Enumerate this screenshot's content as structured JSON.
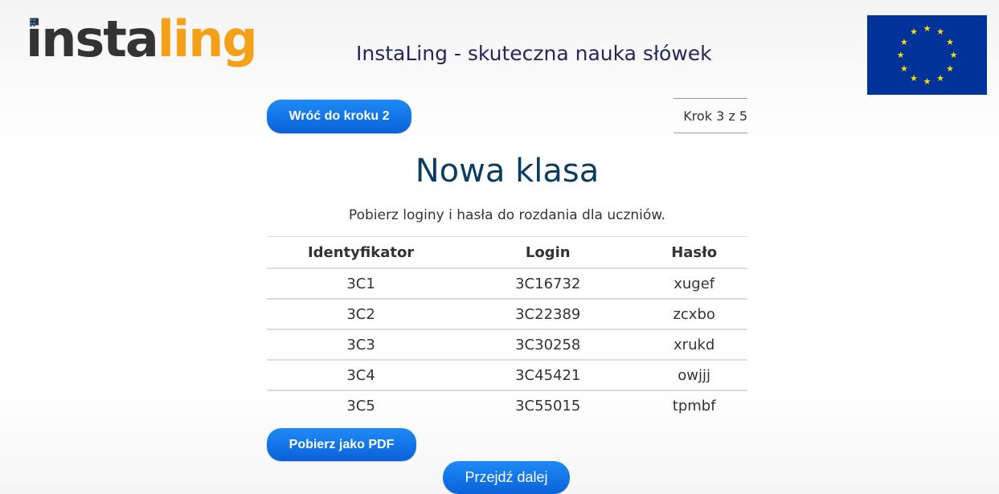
{
  "header": {
    "logo_part1": "insta",
    "logo_part2": "ling",
    "tagline": "InstaLing - skuteczna nauka słówek",
    "eu_flag_icon": "eu-flag-icon"
  },
  "nav": {
    "back_button": "Wróć do kroku 2",
    "step_indicator": "Krok 3 z 5"
  },
  "main": {
    "title": "Nowa klasa",
    "subtitle": "Pobierz loginy i hasła do rozdania dla uczniów.",
    "table": {
      "headers": [
        "Identyfikator",
        "Login",
        "Hasło"
      ],
      "rows": [
        [
          "3C1",
          "3C16732",
          "xugef"
        ],
        [
          "3C2",
          "3C22389",
          "zcxbo"
        ],
        [
          "3C3",
          "3C30258",
          "xrukd"
        ],
        [
          "3C4",
          "3C45421",
          "owjjj"
        ],
        [
          "3C5",
          "3C55015",
          "tpmbf"
        ]
      ]
    }
  },
  "actions": {
    "pdf_button": "Pobierz jako PDF",
    "next_button": "Przejdź dalej"
  },
  "colors": {
    "logo_dark": "#333333",
    "logo_accent": "#f5a019",
    "button_blue": "#0a62d8",
    "title_blue": "#0b3d63",
    "eu_blue": "#003399",
    "eu_yellow": "#ffdd00"
  }
}
